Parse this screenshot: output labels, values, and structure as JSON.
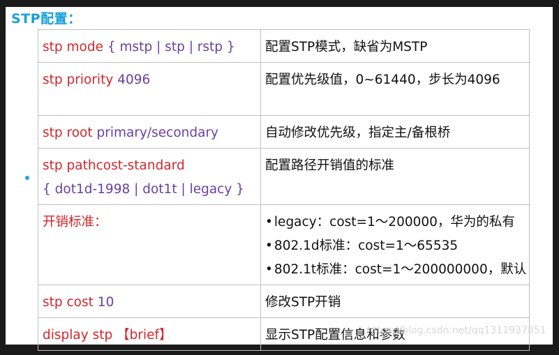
{
  "heading": "STP配置：",
  "rows": [
    {
      "cmd": "stp mode",
      "arg": "{ mstp | stp | rstp }",
      "desc": "配置STP模式，缺省为MSTP"
    },
    {
      "cmd": "stp priority",
      "arg": "4096",
      "desc": "配置优先级值，0~61440，步长为4096"
    },
    {
      "cmd": "stp root",
      "arg": "primary/secondary",
      "desc": "自动修改优先级，指定主/备根桥"
    },
    {
      "cmd": "stp pathcost-standard",
      "arg": "{ dot1d-1998 | dot1t | legacy }",
      "desc": "配置路径开销值的标准"
    },
    {
      "cmd": "开销标准：",
      "items": [
        "legacy：cost=1～200000，华为的私有",
        "802.1d标准：cost=1～65535",
        "802.1t标准：cost=1～200000000，默认"
      ]
    },
    {
      "cmd": "stp cost",
      "arg": "10",
      "desc": "修改STP开销"
    },
    {
      "cmd": "display stp",
      "arg": "【brief】",
      "desc": "显示STP配置信息和参数"
    }
  ],
  "watermark": "https://blog.csdn.net/qq1311937851",
  "colors": {
    "heading": "#17a0d8",
    "command": "#d2262b",
    "argument": "#6a3fa0",
    "border": "#bfbfbf"
  }
}
